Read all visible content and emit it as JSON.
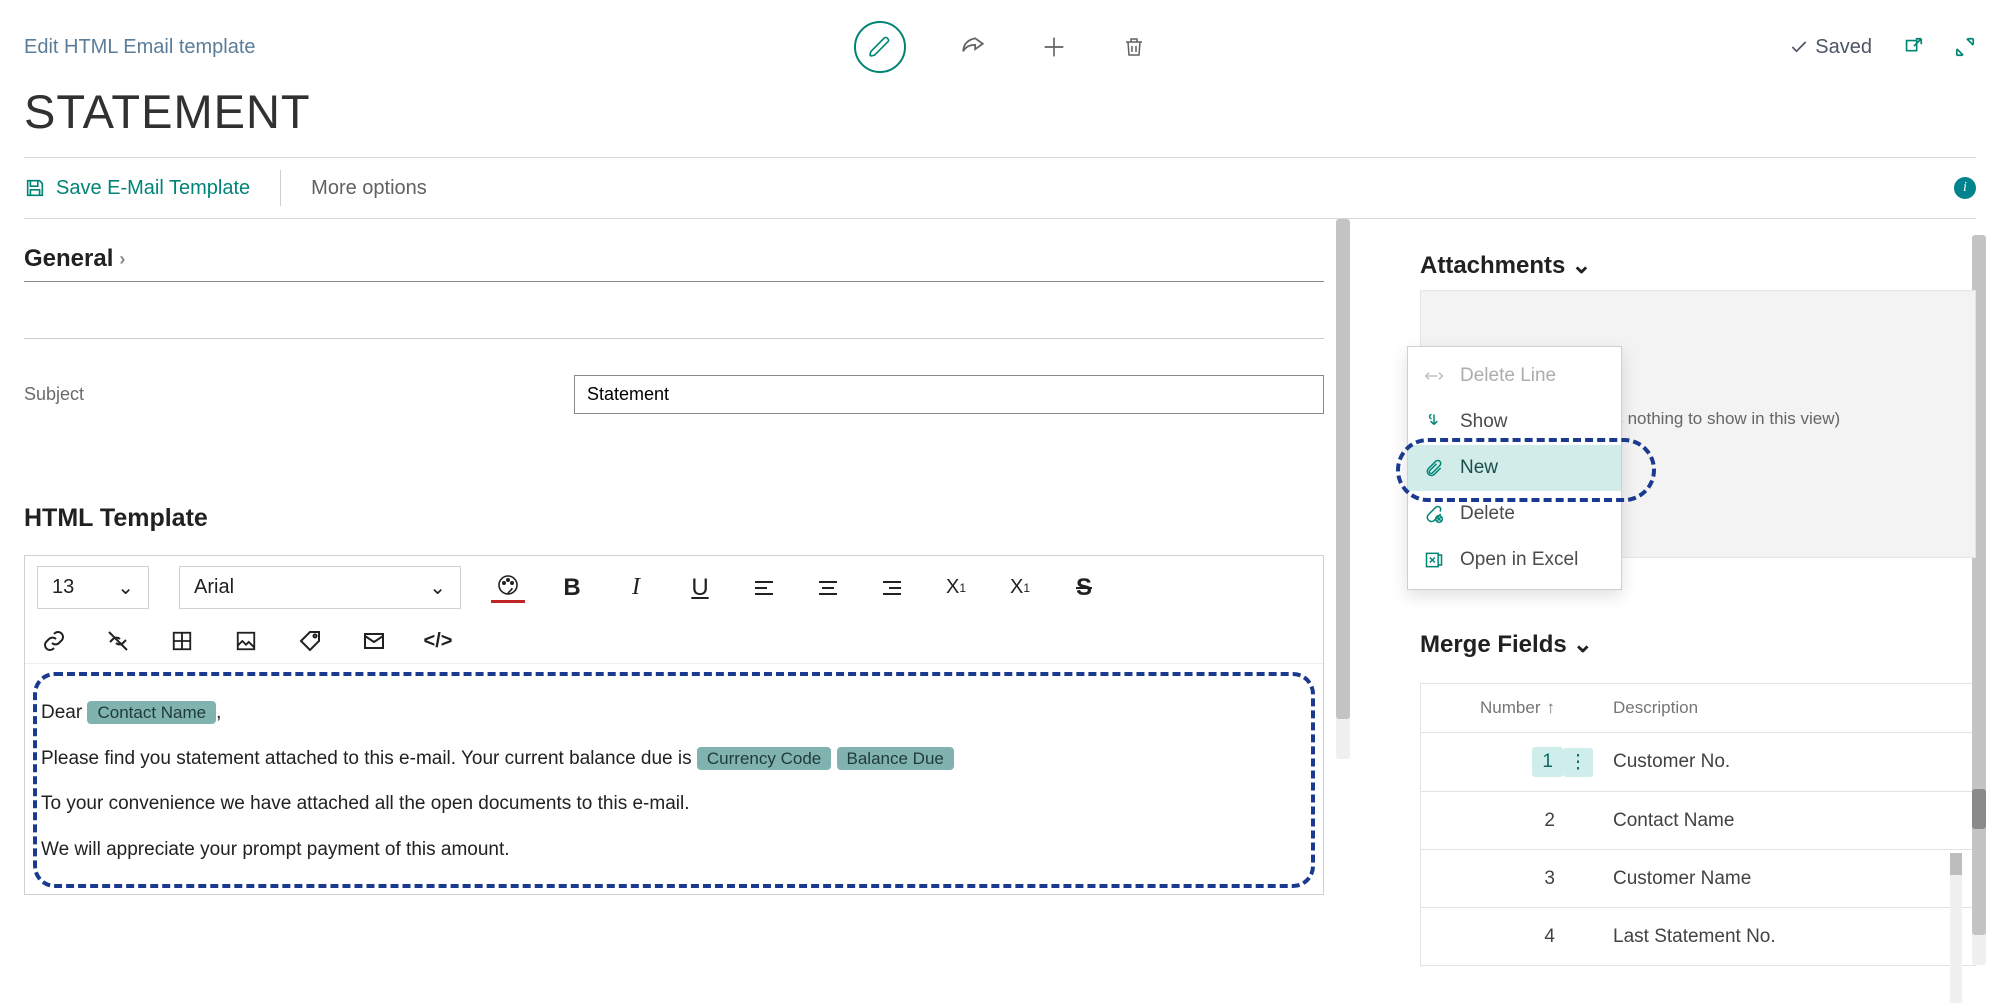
{
  "header": {
    "breadcrumb": "Edit HTML Email template",
    "saved_label": "Saved"
  },
  "page_title": "STATEMENT",
  "command_bar": {
    "save_label": "Save E-Mail Template",
    "more_label": "More options"
  },
  "sections": {
    "general_label": "General",
    "html_template_label": "HTML Template"
  },
  "fields": {
    "subject_label": "Subject",
    "subject_value": "Statement"
  },
  "editor": {
    "font_size": "13",
    "font_name": "Arial",
    "body": {
      "greeting_prefix": "Dear",
      "greeting_chip": "Contact Name",
      "greeting_suffix": ",",
      "line2_prefix": "Please find you statement attached to this e-mail. Your current balance due is",
      "chip_currency": "Currency Code",
      "chip_balance": "Balance Due",
      "line3": "To your convenience we have attached all the open documents to this e-mail.",
      "line4": "We will appreciate your prompt payment of this amount."
    }
  },
  "attachments": {
    "title": "Attachments",
    "empty_text": "(There is nothing to show in this view)",
    "menu": {
      "delete_line": "Delete Line",
      "show": "Show",
      "new": "New",
      "delete": "Delete",
      "open_excel": "Open in Excel"
    }
  },
  "merge_fields": {
    "title": "Merge Fields",
    "columns": {
      "number": "Number",
      "description": "Description"
    },
    "rows": [
      {
        "n": "1",
        "desc": "Customer No."
      },
      {
        "n": "2",
        "desc": "Contact Name"
      },
      {
        "n": "3",
        "desc": "Customer Name"
      },
      {
        "n": "4",
        "desc": "Last Statement No."
      }
    ]
  }
}
